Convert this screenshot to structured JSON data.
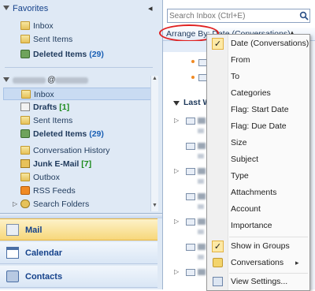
{
  "favorites": {
    "title": "Favorites",
    "collapse_glyph": "◂",
    "items": [
      {
        "label": "Inbox",
        "count": ""
      },
      {
        "label": "Sent Items",
        "count": ""
      },
      {
        "label": "Deleted Items",
        "count": "(29)"
      }
    ]
  },
  "mailbox": {
    "account_suffix": "@",
    "items": [
      {
        "label": "Inbox",
        "count": ""
      },
      {
        "label": "Drafts",
        "count": "[1]"
      },
      {
        "label": "Sent Items",
        "count": ""
      },
      {
        "label": "Deleted Items",
        "count": "(29)"
      },
      {
        "label": "Conversation History",
        "count": ""
      },
      {
        "label": "Junk E-Mail",
        "count": "[7]"
      },
      {
        "label": "Outbox",
        "count": ""
      },
      {
        "label": "RSS Feeds",
        "count": ""
      },
      {
        "label": "Search Folders",
        "count": ""
      }
    ]
  },
  "nav_buttons": [
    "Mail",
    "Calendar",
    "Contacts"
  ],
  "search": {
    "placeholder": "Search Inbox (Ctrl+E)"
  },
  "arrange": {
    "label": "Arrange By: Date (Conversations)",
    "sort_glyph": "▲"
  },
  "list": {
    "group_header": "Last W"
  },
  "menu": {
    "items": [
      {
        "label": "Date (Conversations)",
        "checked": true
      },
      {
        "label": "From"
      },
      {
        "label": "To"
      },
      {
        "label": "Categories"
      },
      {
        "label": "Flag: Start Date"
      },
      {
        "label": "Flag: Due Date"
      },
      {
        "label": "Size"
      },
      {
        "label": "Subject"
      },
      {
        "label": "Type"
      },
      {
        "label": "Attachments"
      },
      {
        "label": "Account"
      },
      {
        "label": "Importance"
      }
    ],
    "show_in_groups": "Show in Groups",
    "conversations": "Conversations",
    "view_settings": "View Settings...",
    "submenu_arrow": "▸",
    "check_glyph": "✓"
  },
  "colors": {
    "annotation_ellipse": "#e02020",
    "accent": "#15428b"
  }
}
